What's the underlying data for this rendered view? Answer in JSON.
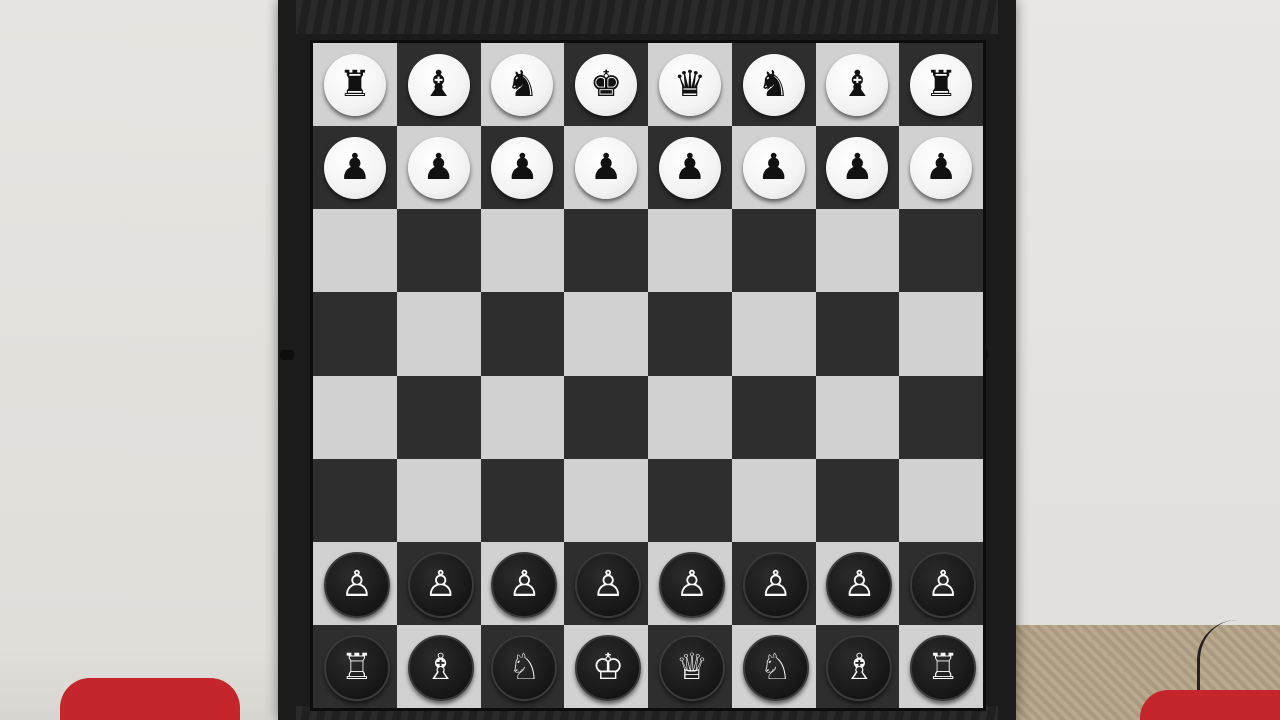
{
  "scene": "magnetic travel chess set on table",
  "board": {
    "rows": [
      [
        {
          "piece": "rook",
          "side": "light-disc"
        },
        {
          "piece": "bishop",
          "side": "light-disc"
        },
        {
          "piece": "knight",
          "side": "light-disc"
        },
        {
          "piece": "king",
          "side": "light-disc"
        },
        {
          "piece": "queen",
          "side": "light-disc"
        },
        {
          "piece": "knight",
          "side": "light-disc"
        },
        {
          "piece": "bishop",
          "side": "light-disc"
        },
        {
          "piece": "rook",
          "side": "light-disc"
        }
      ],
      [
        {
          "piece": "pawn",
          "side": "light-disc"
        },
        {
          "piece": "pawn",
          "side": "light-disc"
        },
        {
          "piece": "pawn",
          "side": "light-disc"
        },
        {
          "piece": "pawn",
          "side": "light-disc"
        },
        {
          "piece": "pawn",
          "side": "light-disc"
        },
        {
          "piece": "pawn",
          "side": "light-disc"
        },
        {
          "piece": "pawn",
          "side": "light-disc"
        },
        {
          "piece": "pawn",
          "side": "light-disc"
        }
      ],
      [
        null,
        null,
        null,
        null,
        null,
        null,
        null,
        null
      ],
      [
        null,
        null,
        null,
        null,
        null,
        null,
        null,
        null
      ],
      [
        null,
        null,
        null,
        null,
        null,
        null,
        null,
        null
      ],
      [
        null,
        null,
        null,
        null,
        null,
        null,
        null,
        null
      ],
      [
        {
          "piece": "pawn",
          "side": "dark-disc"
        },
        {
          "piece": "pawn",
          "side": "dark-disc"
        },
        {
          "piece": "pawn",
          "side": "dark-disc"
        },
        {
          "piece": "pawn",
          "side": "dark-disc"
        },
        {
          "piece": "pawn",
          "side": "dark-disc"
        },
        {
          "piece": "pawn",
          "side": "dark-disc"
        },
        {
          "piece": "pawn",
          "side": "dark-disc"
        },
        {
          "piece": "pawn",
          "side": "dark-disc"
        }
      ],
      [
        {
          "piece": "rook",
          "side": "dark-disc"
        },
        {
          "piece": "bishop",
          "side": "dark-disc"
        },
        {
          "piece": "knight",
          "side": "dark-disc"
        },
        {
          "piece": "king",
          "side": "dark-disc"
        },
        {
          "piece": "queen",
          "side": "dark-disc"
        },
        {
          "piece": "knight",
          "side": "dark-disc"
        },
        {
          "piece": "bishop",
          "side": "dark-disc"
        },
        {
          "piece": "rook",
          "side": "dark-disc"
        }
      ]
    ],
    "colors": {
      "light_square": "#d1d1d1",
      "dark_square": "#2e2e2e",
      "frame": "#1b1b1b"
    }
  },
  "glyphs": {
    "light-disc": {
      "king": "♚",
      "queen": "♛",
      "rook": "♜",
      "bishop": "♝",
      "knight": "♞",
      "pawn": "♟"
    },
    "dark-disc": {
      "king": "♔",
      "queen": "♕",
      "rook": "♖",
      "bishop": "♗",
      "knight": "♘",
      "pawn": "♙"
    }
  }
}
